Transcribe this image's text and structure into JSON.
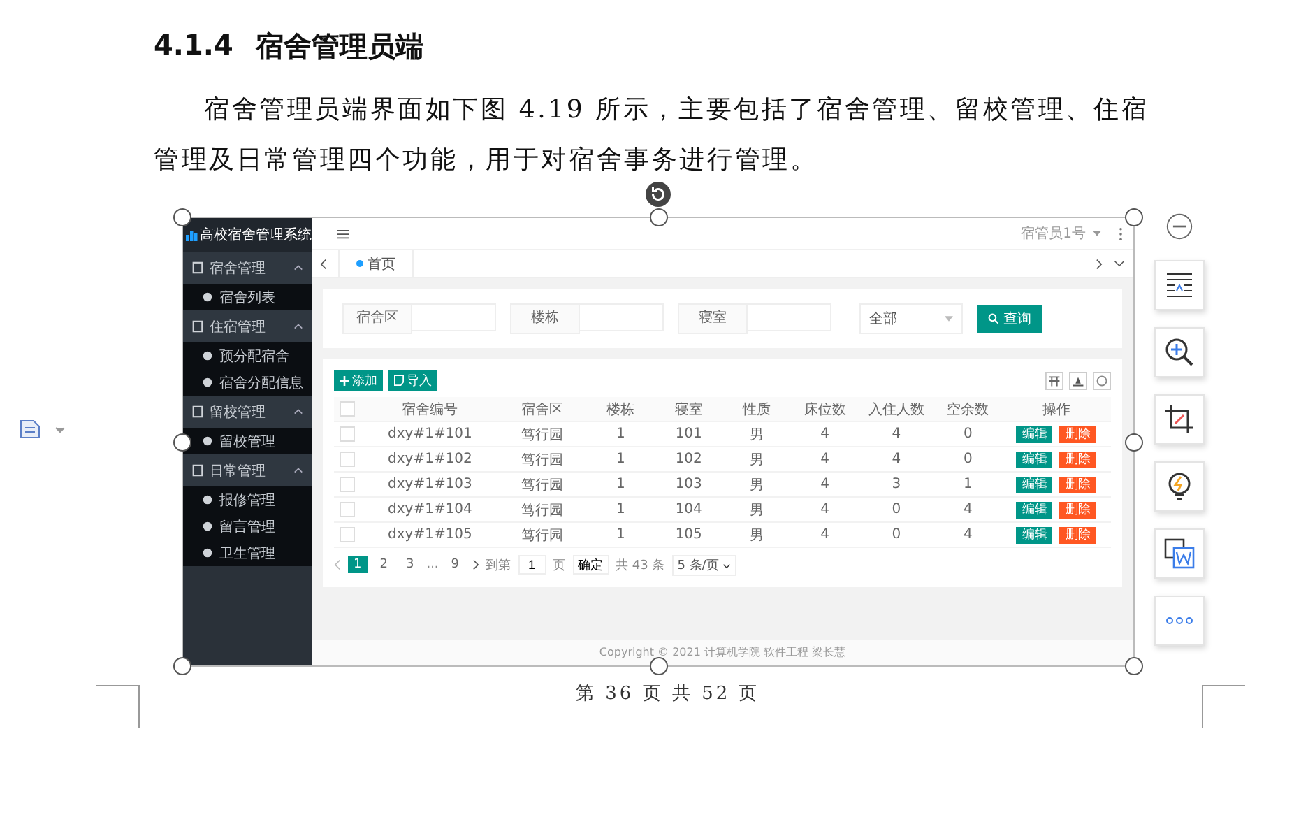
{
  "heading": {
    "number": "4.1.4",
    "title": "宿舍管理员端"
  },
  "paragraph": "宿舍管理员端界面如下图 4.19 所示，主要包括了宿舍管理、留校管理、住宿管理及日常管理四个功能，用于对宿舍事务进行管理。",
  "figure": {
    "brand": "高校宿舍管理系统",
    "user": "宿管员1号",
    "tabs": [
      {
        "label": "首页",
        "selected": true
      }
    ],
    "sidebar": [
      {
        "label": "宿舍管理",
        "expanded": true,
        "children": [
          {
            "label": "宿舍列表"
          }
        ]
      },
      {
        "label": "住宿管理",
        "expanded": true,
        "children": [
          {
            "label": "预分配宿舍"
          },
          {
            "label": "宿舍分配信息"
          }
        ]
      },
      {
        "label": "留校管理",
        "expanded": true,
        "children": [
          {
            "label": "留校管理"
          }
        ]
      },
      {
        "label": "日常管理",
        "expanded": true,
        "children": [
          {
            "label": "报修管理"
          },
          {
            "label": "留言管理"
          },
          {
            "label": "卫生管理"
          }
        ]
      }
    ],
    "search": {
      "fields": [
        {
          "label": "宿舍区"
        },
        {
          "label": "楼栋"
        },
        {
          "label": "寝室"
        }
      ],
      "select": "全部",
      "button": "查询"
    },
    "toolbar_buttons": [
      "添加",
      "导入"
    ],
    "table": {
      "header_checked": false,
      "columns": [
        "宿舍编号",
        "宿舍区",
        "楼栋",
        "寝室",
        "性质",
        "床位数",
        "入住人数",
        "空余数",
        "操作"
      ],
      "rows": [
        {
          "checked": false,
          "cells": [
            "dxy#1#101",
            "笃行园",
            "1",
            "101",
            "男",
            "4",
            "4",
            "0"
          ],
          "actions": [
            "编辑",
            "删除"
          ]
        },
        {
          "checked": false,
          "cells": [
            "dxy#1#102",
            "笃行园",
            "1",
            "102",
            "男",
            "4",
            "4",
            "0"
          ],
          "actions": [
            "编辑",
            "删除"
          ]
        },
        {
          "checked": false,
          "cells": [
            "dxy#1#103",
            "笃行园",
            "1",
            "103",
            "男",
            "4",
            "3",
            "1"
          ],
          "actions": [
            "编辑",
            "删除"
          ]
        },
        {
          "checked": false,
          "cells": [
            "dxy#1#104",
            "笃行园",
            "1",
            "104",
            "男",
            "4",
            "0",
            "4"
          ],
          "actions": [
            "编辑",
            "删除"
          ]
        },
        {
          "checked": false,
          "cells": [
            "dxy#1#105",
            "笃行园",
            "1",
            "105",
            "男",
            "4",
            "0",
            "4"
          ],
          "actions": [
            "编辑",
            "删除"
          ]
        }
      ]
    },
    "pagination": {
      "pages": [
        {
          "label": "1",
          "selected": true
        },
        {
          "label": "2",
          "selected": false
        },
        {
          "label": "3",
          "selected": false
        }
      ],
      "ellipsis": "...",
      "last_page": "9",
      "goto_label": "到第",
      "goto_value": "1",
      "page_unit": "页",
      "confirm": "确定",
      "total": "共 43 条",
      "page_size": "5 条/页"
    },
    "footer": "Copyright © 2021 计算机学院 软件工程 梁长慧"
  },
  "page_footer": "第 36 页 共 52 页"
}
